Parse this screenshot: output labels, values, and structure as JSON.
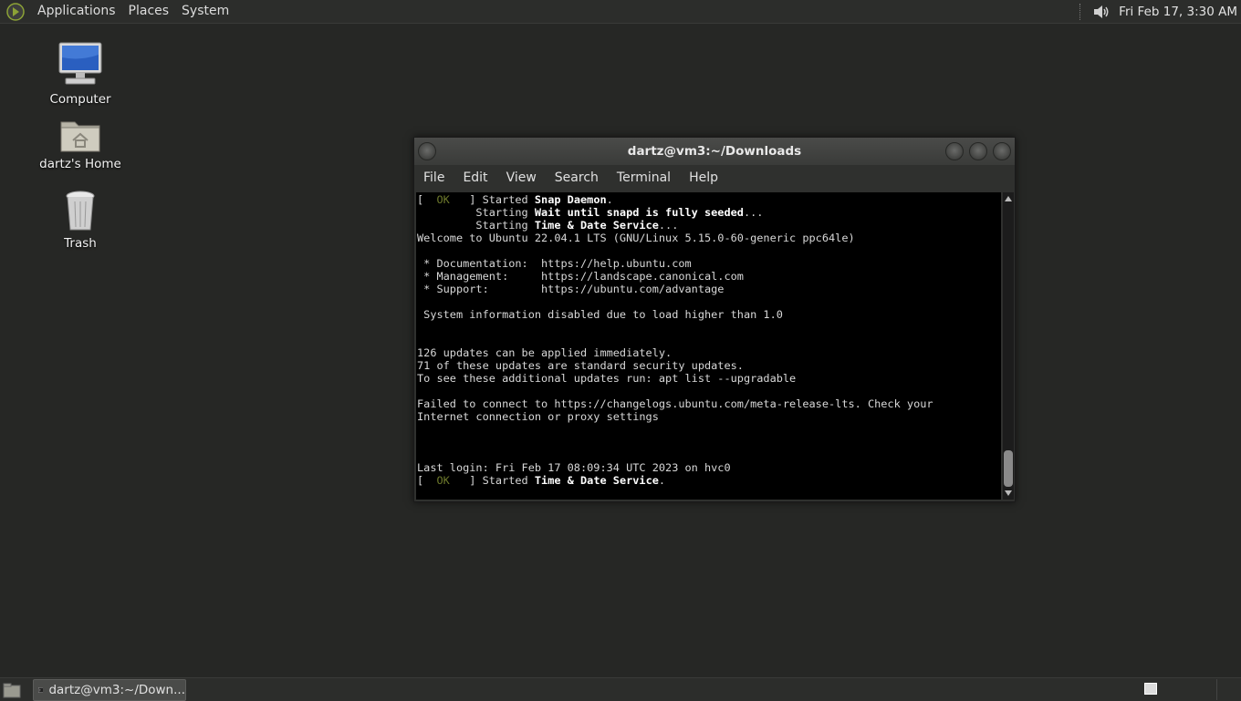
{
  "top_panel": {
    "menus": [
      "Applications",
      "Places",
      "System"
    ],
    "clock": "Fri Feb 17,  3:30 AM"
  },
  "desktop_icons": [
    {
      "label": "Computer"
    },
    {
      "label": "dartz's Home"
    },
    {
      "label": "Trash"
    }
  ],
  "terminal": {
    "title": "dartz@vm3:~/Downloads",
    "menu": [
      "File",
      "Edit",
      "View",
      "Search",
      "Terminal",
      "Help"
    ],
    "lines": [
      {
        "ok": true,
        "pre": " ] Started ",
        "bold": "Snap Daemon",
        "post": "."
      },
      {
        "ok": false,
        "pre": "         Starting ",
        "bold": "Wait until snapd is fully seeded",
        "post": "..."
      },
      {
        "ok": false,
        "pre": "         Starting ",
        "bold": "Time & Date Service",
        "post": "..."
      },
      {
        "ok": false,
        "pre": "Welcome to Ubuntu 22.04.1 LTS (GNU/Linux 5.15.0-60-generic ppc64le)",
        "bold": "",
        "post": ""
      },
      {
        "ok": false,
        "pre": "",
        "bold": "",
        "post": ""
      },
      {
        "ok": false,
        "pre": " * Documentation:  https://help.ubuntu.com",
        "bold": "",
        "post": ""
      },
      {
        "ok": false,
        "pre": " * Management:     https://landscape.canonical.com",
        "bold": "",
        "post": ""
      },
      {
        "ok": false,
        "pre": " * Support:        https://ubuntu.com/advantage",
        "bold": "",
        "post": ""
      },
      {
        "ok": false,
        "pre": "",
        "bold": "",
        "post": ""
      },
      {
        "ok": false,
        "pre": " System information disabled due to load higher than 1.0",
        "bold": "",
        "post": ""
      },
      {
        "ok": false,
        "pre": "",
        "bold": "",
        "post": ""
      },
      {
        "ok": false,
        "pre": "",
        "bold": "",
        "post": ""
      },
      {
        "ok": false,
        "pre": "126 updates can be applied immediately.",
        "bold": "",
        "post": ""
      },
      {
        "ok": false,
        "pre": "71 of these updates are standard security updates.",
        "bold": "",
        "post": ""
      },
      {
        "ok": false,
        "pre": "To see these additional updates run: apt list --upgradable",
        "bold": "",
        "post": ""
      },
      {
        "ok": false,
        "pre": "",
        "bold": "",
        "post": ""
      },
      {
        "ok": false,
        "pre": "Failed to connect to https://changelogs.ubuntu.com/meta-release-lts. Check your",
        "bold": "",
        "post": ""
      },
      {
        "ok": false,
        "pre": "Internet connection or proxy settings",
        "bold": "",
        "post": ""
      },
      {
        "ok": false,
        "pre": "",
        "bold": "",
        "post": ""
      },
      {
        "ok": false,
        "pre": "",
        "bold": "",
        "post": ""
      },
      {
        "ok": false,
        "pre": "",
        "bold": "",
        "post": ""
      },
      {
        "ok": false,
        "pre": "Last login: Fri Feb 17 08:09:34 UTC 2023 on hvc0",
        "bold": "",
        "post": ""
      },
      {
        "ok": true,
        "pre": " ] Started ",
        "bold": "Time & Date Service",
        "post": "."
      }
    ]
  },
  "taskbar": {
    "task_label": "dartz@vm3:~/Down..."
  }
}
